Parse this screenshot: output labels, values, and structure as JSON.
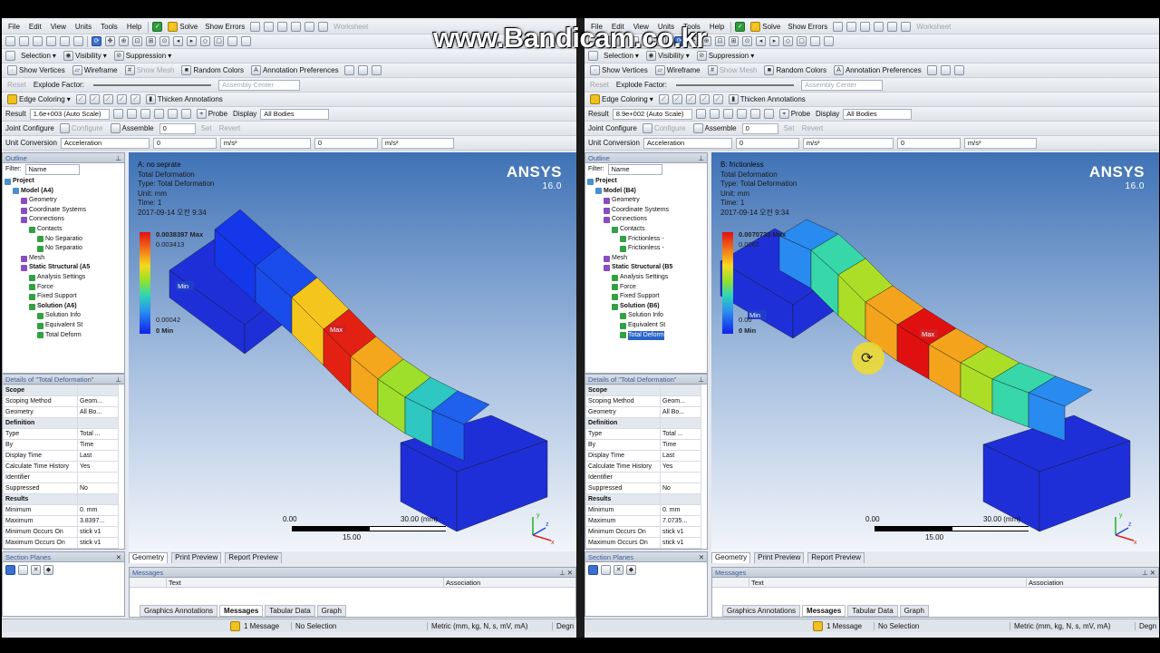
{
  "watermark": "www.Bandicam.co.kr",
  "menu": [
    "File",
    "Edit",
    "View",
    "Units",
    "Tools",
    "Help"
  ],
  "toolbar": {
    "solve": "Solve",
    "show_errors": "Show Errors",
    "worksheet": "Worksheet",
    "selection": "Selection",
    "visibility": "Visibility",
    "suppression": "Suppression",
    "show_vertices": "Show Vertices",
    "wireframe": "Wireframe",
    "show_mesh": "Show Mesh",
    "random_colors": "Random Colors",
    "annotation_preferences": "Annotation Preferences",
    "reset": "Reset",
    "explode_factor": "Explode Factor:",
    "assembly_center": "Assembly Center",
    "edge_coloring": "Edge Coloring",
    "thicken_annotations": "Thicken Annotations",
    "result": "Result",
    "probe": "Probe",
    "display": "Display",
    "all_bodies": "All Bodies",
    "joint_configure": "Joint Configure",
    "configure": "Configure",
    "assemble": "Assemble",
    "zero": "0",
    "set": "Set",
    "revert": "Revert",
    "unit_conversion": "Unit Conversion",
    "acceleration": "Acceleration",
    "ms2": "m/s²"
  },
  "outline": {
    "title": "Outline",
    "filter": "Filter:",
    "filter_value": "Name"
  },
  "details": {
    "title": "Details of \"Total Deformation\"",
    "rows": [
      {
        "k": "Scope",
        "v": "",
        "h": true
      },
      {
        "k": "Scoping Method",
        "v": "Geom..."
      },
      {
        "k": "Geometry",
        "v": "All Bo..."
      },
      {
        "k": "Definition",
        "v": "",
        "h": true
      },
      {
        "k": "Type",
        "v": "Total ..."
      },
      {
        "k": "By",
        "v": "Time"
      },
      {
        "k": "Display Time",
        "v": "Last"
      },
      {
        "k": "Calculate Time History",
        "v": "Yes"
      },
      {
        "k": "Identifier",
        "v": ""
      },
      {
        "k": "Suppressed",
        "v": "No"
      },
      {
        "k": "Results",
        "v": "",
        "h": true
      },
      {
        "k": "Minimum",
        "v": "0. mm"
      },
      {
        "k": "Maximum",
        "v": "3.8397..."
      },
      {
        "k": "Minimum Occurs On",
        "v": "stick v1"
      },
      {
        "k": "Maximum Occurs On",
        "v": "stick v1"
      }
    ]
  },
  "section_planes": "Section Planes",
  "messages": {
    "title": "Messages",
    "col_text": "Text",
    "col_assoc": "Association"
  },
  "bottom_tabs": [
    "Graphics Annotations",
    "Messages",
    "Tabular Data",
    "Graph"
  ],
  "viewport_tabs": [
    "Geometry",
    "Print Preview",
    "Report Preview"
  ],
  "status": {
    "message": "1 Message",
    "selection": "No Selection",
    "units": "Metric (mm, kg, N, s, mV, mA)",
    "degree": "Degn"
  },
  "brand": {
    "name": "ANSYS",
    "version": "16.0"
  },
  "scale": {
    "left": "0.00",
    "right": "30.00 (mm)",
    "mid": "15.00"
  },
  "left": {
    "result_value": "1.6e+003 (Auto Scale)",
    "title": "A: no seprate",
    "l2": "Total Deformation",
    "l3": "Type: Total Deformation",
    "l4": "Unit: mm",
    "l5": "Time: 1",
    "l6": "2017-09-14 오전 9:34",
    "legend_max": "0.0038397 Max",
    "legend_2": "0.003413",
    "legend_min2": "0.00042",
    "legend_min": "0 Min",
    "tree": [
      {
        "t": "Project",
        "d": 0,
        "b": true
      },
      {
        "t": "Model (A4)",
        "d": 1,
        "b": true
      },
      {
        "t": "Geometry",
        "d": 2
      },
      {
        "t": "Coordinate Systems",
        "d": 2
      },
      {
        "t": "Connections",
        "d": 2
      },
      {
        "t": "Contacts",
        "d": 3
      },
      {
        "t": "No Separatio",
        "d": 4
      },
      {
        "t": "No Separatio",
        "d": 4
      },
      {
        "t": "Mesh",
        "d": 2
      },
      {
        "t": "Static Structural (A5",
        "d": 2,
        "b": true
      },
      {
        "t": "Analysis Settings",
        "d": 3
      },
      {
        "t": "Force",
        "d": 3
      },
      {
        "t": "Fixed Support",
        "d": 3
      },
      {
        "t": "Solution (A6)",
        "d": 3,
        "b": true
      },
      {
        "t": "Solution Info",
        "d": 4
      },
      {
        "t": "Equivalent St",
        "d": 4
      },
      {
        "t": "Total Deform",
        "d": 4
      }
    ]
  },
  "right": {
    "result_value": "8.9e+002 (Auto Scale)",
    "title": "B: frictionless",
    "l2": "Total Deformation",
    "l3": "Type: Total Deformation",
    "l4": "Unit: mm",
    "l5": "Time: 1",
    "l6": "2017-09-14 오전 9:34",
    "legend_max": "0.0070735 Max",
    "legend_2": "0.0062",
    "legend_min2": "0.00",
    "legend_min": "0 Min",
    "details_max": "7.0735...",
    "tree": [
      {
        "t": "Project",
        "d": 0,
        "b": true
      },
      {
        "t": "Model (B4)",
        "d": 1,
        "b": true
      },
      {
        "t": "Geometry",
        "d": 2
      },
      {
        "t": "Coordinate Systems",
        "d": 2
      },
      {
        "t": "Connections",
        "d": 2
      },
      {
        "t": "Contacts",
        "d": 3
      },
      {
        "t": "Frictionless -",
        "d": 4
      },
      {
        "t": "Frictionless -",
        "d": 4
      },
      {
        "t": "Mesh",
        "d": 2
      },
      {
        "t": "Static Structural (B5",
        "d": 2,
        "b": true
      },
      {
        "t": "Analysis Settings",
        "d": 3
      },
      {
        "t": "Force",
        "d": 3
      },
      {
        "t": "Fixed Support",
        "d": 3
      },
      {
        "t": "Solution (B6)",
        "d": 3,
        "b": true
      },
      {
        "t": "Solution Info",
        "d": 4
      },
      {
        "t": "Equivalent St",
        "d": 4
      },
      {
        "t": "Total Deform",
        "d": 4,
        "sel": true
      }
    ]
  },
  "min_tag": "Min",
  "max_tag": "Max",
  "colors": {
    "legend_top": "#e01010",
    "legend_bottom": "#1022e8",
    "background_top": "#3f72b6"
  }
}
